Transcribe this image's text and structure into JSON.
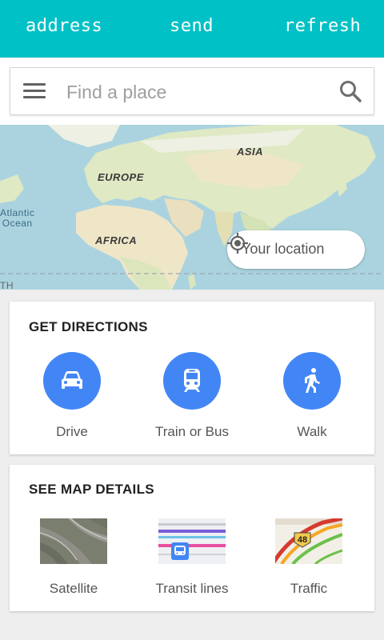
{
  "topbar": {
    "address_label": "address",
    "send_label": "send",
    "refresh_label": "refresh",
    "bg_color": "#00c1c6"
  },
  "search": {
    "placeholder": "Find a place",
    "menu_icon": "hamburger-menu-icon",
    "search_icon": "magnifier-icon"
  },
  "map": {
    "labels": {
      "asia": "ASIA",
      "europe": "EUROPE",
      "africa": "AFRICA",
      "atlantic": "Atlantic\nOcean",
      "edge": "TH"
    },
    "location_button": "Your location",
    "location_icon": "my-location-icon"
  },
  "directions": {
    "title": "GET DIRECTIONS",
    "accent": "#4286f5",
    "modes": [
      {
        "label": "Drive",
        "icon": "car-icon"
      },
      {
        "label": "Train or Bus",
        "icon": "train-icon"
      },
      {
        "label": "Walk",
        "icon": "walk-icon"
      }
    ]
  },
  "details": {
    "title": "SEE MAP DETAILS",
    "items": [
      {
        "label": "Satellite",
        "icon": "satellite-thumbnail"
      },
      {
        "label": "Transit lines",
        "icon": "transit-thumbnail"
      },
      {
        "label": "Traffic",
        "icon": "traffic-thumbnail",
        "badge": "48"
      }
    ]
  }
}
